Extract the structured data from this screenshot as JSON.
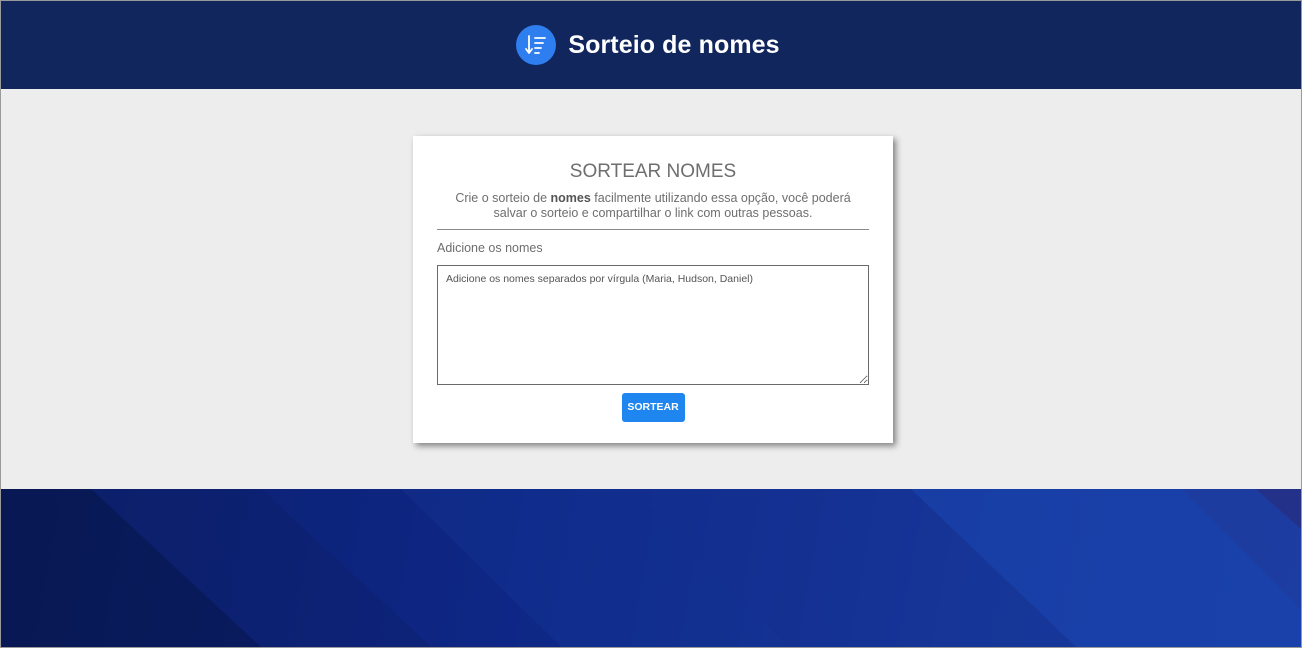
{
  "header": {
    "title": "Sorteio de nomes",
    "logo_icon": "sorted-list-icon"
  },
  "card": {
    "title": "SORTEAR NOMES",
    "description_before": "Crie o sorteio de ",
    "description_bold": "nomes",
    "description_after": " facilmente utilizando essa opção, você poderá salvar o sorteio e compartilhar o link com outras pessoas.",
    "field_label": "Adicione os nomes",
    "names_input": {
      "value": "",
      "placeholder": "Adicione os nomes separados por vírgula (Maria, Hudson, Daniel)"
    },
    "submit_label": "SORTEAR"
  },
  "colors": {
    "header_bg": "#12265e",
    "accent": "#2f7ef0",
    "button_bg": "#1f86ef",
    "page_bg": "#ededed",
    "footer_bg": "#10298a"
  }
}
